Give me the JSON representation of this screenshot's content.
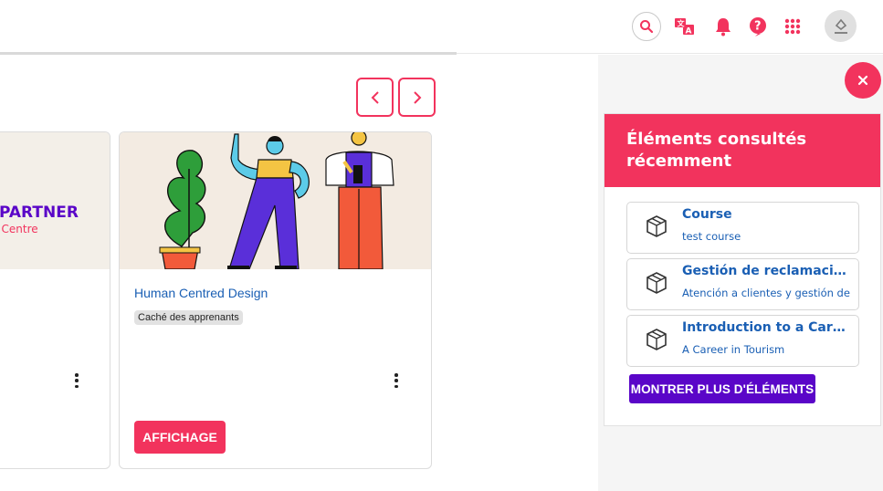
{
  "header": {
    "icons": [
      "search-icon",
      "translate-icon",
      "bell-icon",
      "help-icon",
      "apps-grid-icon",
      "avatar-icon"
    ],
    "accent": "#f2335d"
  },
  "carousel": {
    "prev_icon": "chevron-left-icon",
    "next_icon": "chevron-right-icon"
  },
  "cards": [
    {
      "logo_line1": "PARTNER",
      "logo_line2": "t Centre"
    },
    {
      "title": "Human Centred Design",
      "badge": "Caché des apprenants",
      "view_label": "AFFICHAGE"
    }
  ],
  "drawer": {
    "title": "Éléments consultés récemment",
    "items": [
      {
        "title": "Course",
        "subtitle": "test course",
        "icon": "box-icon"
      },
      {
        "title": "Gestión de reclamaciones",
        "subtitle": "Atención a clientes y gestión de",
        "icon": "box-icon"
      },
      {
        "title": "Introduction to a Career in Tourism",
        "subtitle": "A Career in Tourism",
        "icon": "box-icon"
      }
    ],
    "more_label": "MONTRER PLUS D'ÉLÉMENTS"
  },
  "colors": {
    "accent": "#f2335d",
    "link": "#1a5fb4",
    "purple": "#5a06c8"
  }
}
